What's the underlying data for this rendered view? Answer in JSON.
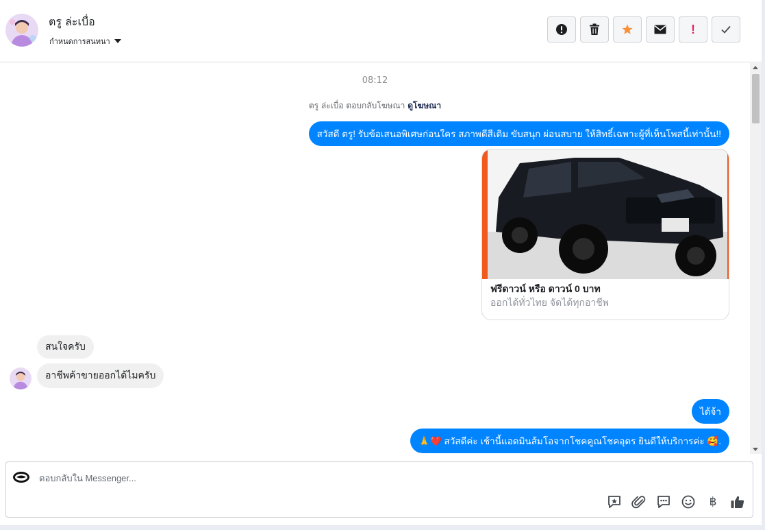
{
  "header": {
    "contact_name": "ตรู ล่ะเบื่อ",
    "conversation_settings_label": "กำหนดการสนทนา",
    "toolbar": {
      "icons": [
        "alert-circle-icon",
        "trash-icon",
        "star-icon",
        "envelope-icon",
        "exclamation-icon",
        "check-icon"
      ],
      "exclamation_text": "!",
      "star_color": "#f7923a"
    }
  },
  "messages": {
    "timestamp": "08:12",
    "reply_note_prefix": "ตรู ล่ะเบื่อ ตอบกลับโฆษณา",
    "reply_note_link": "ดูโฆษณา",
    "outgoing_1": "สวัสดี ตรู! รับข้อเสนอพิเศษก่อนใคร สภาพดีสีเดิม ขับสนุก ผ่อนสบาย ให้สิทธิ์เฉพาะผู้ที่เห็นโพสนี้เท่านั้น!!",
    "ad_card": {
      "title": "ฟรีดาวน์ หรือ ดาวน์ 0 บาท",
      "subtitle": "ออกได้ทั่วไทย จัดได้ทุกอาชีพ",
      "accent_color": "#f05a1e"
    },
    "incoming_1": "สนใจครับ",
    "incoming_2": "อาชีพค้าขายออกได้ไมครับ",
    "outgoing_2": "ได้จ้า",
    "outgoing_3": "🙏❤️ สวัสดีค่ะ เช้านี้แอดมินส้มโอจากโชคคูณโชคอุดร ยินดีให้บริการค่ะ 🥰.",
    "bubble_color": "#0084ff"
  },
  "composer": {
    "placeholder": "ตอบกลับใน Messenger...",
    "tools": [
      "sticker-icon",
      "attachment-icon",
      "saved-replies-icon",
      "emoji-icon",
      "baht-icon",
      "thumbs-up-icon"
    ],
    "baht_symbol": "฿"
  }
}
